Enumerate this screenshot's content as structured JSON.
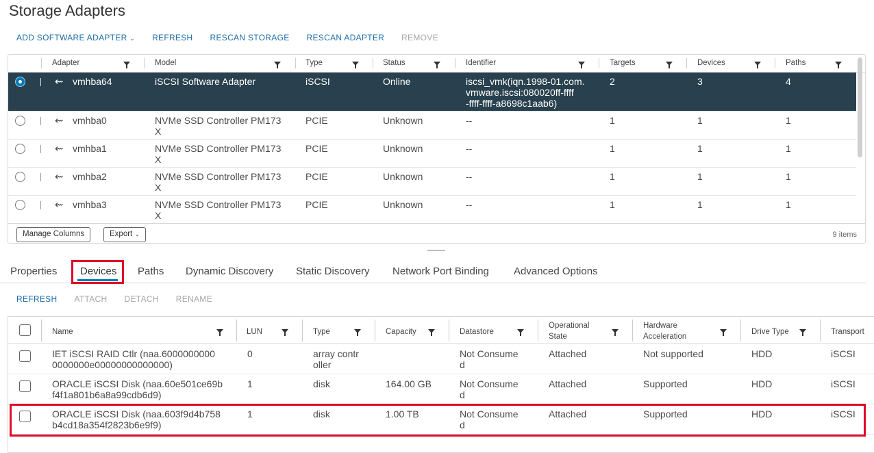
{
  "page_title": "Storage Adapters",
  "toolbar": {
    "add_software_adapter": "ADD SOFTWARE ADAPTER",
    "refresh": "REFRESH",
    "rescan_storage": "RESCAN STORAGE",
    "rescan_adapter": "RESCAN ADAPTER",
    "remove": "REMOVE"
  },
  "adapters": {
    "columns": [
      "Adapter",
      "Model",
      "Type",
      "Status",
      "Identifier",
      "Targets",
      "Devices",
      "Paths"
    ],
    "rows": [
      {
        "adapter": "vmhba64",
        "model": "iSCSI Software Adapter",
        "type": "iSCSI",
        "status": "Online",
        "identifier": "iscsi_vmk(iqn.1998-01.com.\nvmware.iscsi:080020ff-ffff\n-ffff-ffff-a8698c1aab6)",
        "targets": "2",
        "devices": "3",
        "paths": "4",
        "selected": true
      },
      {
        "adapter": "vmhba0",
        "model": "NVMe SSD Controller PM173\nX",
        "type": "PCIE",
        "status": "Unknown",
        "identifier": "--",
        "targets": "1",
        "devices": "1",
        "paths": "1",
        "selected": false
      },
      {
        "adapter": "vmhba1",
        "model": "NVMe SSD Controller PM173\nX",
        "type": "PCIE",
        "status": "Unknown",
        "identifier": "--",
        "targets": "1",
        "devices": "1",
        "paths": "1",
        "selected": false
      },
      {
        "adapter": "vmhba2",
        "model": "NVMe SSD Controller PM173\nX",
        "type": "PCIE",
        "status": "Unknown",
        "identifier": "--",
        "targets": "1",
        "devices": "1",
        "paths": "1",
        "selected": false
      },
      {
        "adapter": "vmhba3",
        "model": "NVMe SSD Controller PM173\nX",
        "type": "PCIE",
        "status": "Unknown",
        "identifier": "--",
        "targets": "1",
        "devices": "1",
        "paths": "1",
        "selected": false
      }
    ],
    "manage_columns": "Manage Columns",
    "export": "Export",
    "item_count": "9 items"
  },
  "tabs": [
    "Properties",
    "Devices",
    "Paths",
    "Dynamic Discovery",
    "Static Discovery",
    "Network Port Binding",
    "Advanced Options"
  ],
  "active_tab": "Devices",
  "devices_toolbar": {
    "refresh": "REFRESH",
    "attach": "ATTACH",
    "detach": "DETACH",
    "rename": "RENAME"
  },
  "devices": {
    "columns": [
      "Name",
      "LUN",
      "Type",
      "Capacity",
      "Datastore",
      "Operational\nState",
      "Hardware\nAcceleration",
      "Drive Type",
      "Transport"
    ],
    "rows": [
      {
        "name": "IET iSCSI RAID Ctlr (naa.6000000000\n0000000e00000000000000)",
        "lun": "0",
        "type": "array contr\noller",
        "capacity": "",
        "datastore": "Not Consume\nd",
        "state": "Attached",
        "accel": "Not supported",
        "drive": "HDD",
        "transport": "iSCSI"
      },
      {
        "name": "ORACLE iSCSI Disk (naa.60e501ce69b\nf4f1a801b6a8a99cdb6d9)",
        "lun": "1",
        "type": "disk",
        "capacity": "164.00 GB",
        "datastore": "Not Consume\nd",
        "state": "Attached",
        "accel": "Supported",
        "drive": "HDD",
        "transport": "iSCSI"
      },
      {
        "name": "ORACLE iSCSI Disk (naa.603f9d4b758\nb4cd18a354f2823b6e9f9)",
        "lun": "1",
        "type": "disk",
        "capacity": "1.00 TB",
        "datastore": "Not Consume\nd",
        "state": "Attached",
        "accel": "Supported",
        "drive": "HDD",
        "transport": "iSCSI"
      }
    ]
  },
  "colors": {
    "accent": "#0079b8",
    "selected_row": "#29414e",
    "highlight": "#e00b28",
    "link": "#1f6ea7"
  }
}
